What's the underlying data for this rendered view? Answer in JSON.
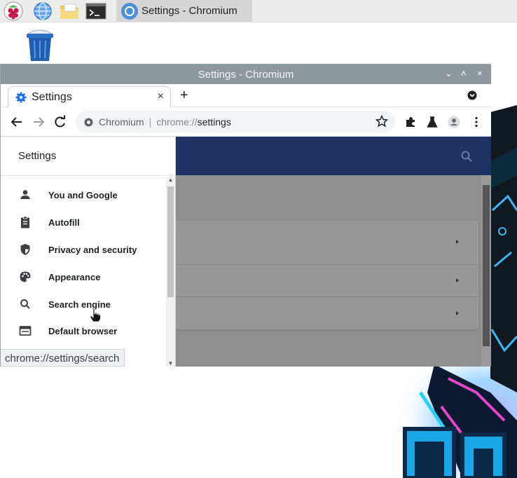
{
  "taskbar": {
    "launchers": [
      "raspberry-menu-icon",
      "web-browser-icon",
      "file-manager-icon",
      "terminal-icon"
    ],
    "task_label": "Settings - Chromium"
  },
  "desktop": {
    "trash_icon": "trash-icon"
  },
  "window": {
    "title": "Settings - Chromium",
    "controls": {
      "minimize": "⌄",
      "maximize": "˄",
      "close": "×"
    }
  },
  "tabs": {
    "active_title": "Settings",
    "close_glyph": "×",
    "new_tab_glyph": "+"
  },
  "omnibox": {
    "site_label": "Chromium",
    "separator": "|",
    "scheme": "chrome://",
    "path": "settings"
  },
  "drawer": {
    "title": "Settings",
    "items": [
      {
        "label": "You and Google",
        "icon": "person-icon"
      },
      {
        "label": "Autofill",
        "icon": "clipboard-icon"
      },
      {
        "label": "Privacy and security",
        "icon": "shield-icon"
      },
      {
        "label": "Appearance",
        "icon": "palette-icon"
      },
      {
        "label": "Search engine",
        "icon": "search-icon"
      },
      {
        "label": "Default browser",
        "icon": "browser-window-icon"
      }
    ]
  },
  "status_tooltip": "chrome://settings/search",
  "colors": {
    "settings_header": "#1f3266",
    "titlebar": "#8e979c",
    "taskbar": "#ececec"
  }
}
